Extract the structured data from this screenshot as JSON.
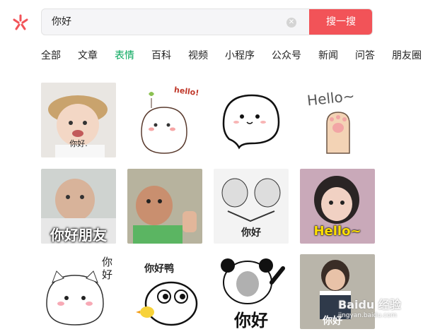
{
  "search": {
    "query": "你好",
    "button": "搜一搜"
  },
  "tabs": [
    {
      "label": "全部"
    },
    {
      "label": "文章"
    },
    {
      "label": "表情",
      "active": true
    },
    {
      "label": "百科"
    },
    {
      "label": "视频"
    },
    {
      "label": "小程序"
    },
    {
      "label": "公众号"
    },
    {
      "label": "新闻"
    },
    {
      "label": "问答"
    },
    {
      "label": "朋友圈"
    }
  ],
  "stickers": {
    "s1": {
      "caption": "你好."
    },
    "s2": {
      "caption": "hello!"
    },
    "s3": {
      "caption": ""
    },
    "s4": {
      "caption": "Hello~"
    },
    "s5": {
      "caption": "你好朋友"
    },
    "s6": {
      "caption": ""
    },
    "s7": {
      "caption": "你好"
    },
    "s8": {
      "caption": "Hello~"
    },
    "s9": {
      "caption": "你好"
    },
    "s10": {
      "caption": "你好鸭"
    },
    "s11": {
      "caption": "你好"
    },
    "s12": {
      "caption": "你好"
    }
  },
  "watermark": {
    "text": "Baidu 经验",
    "sub": "jingyan.baidu.com"
  },
  "colors": {
    "accent": "#f25358",
    "active_tab": "#07a75c"
  }
}
